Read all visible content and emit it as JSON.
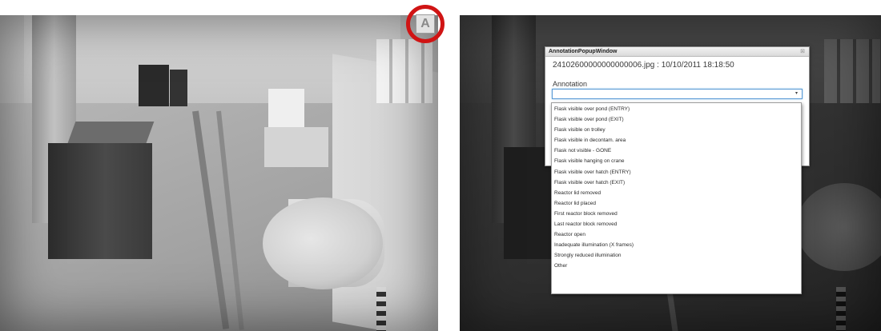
{
  "overlay_button": {
    "label": "A"
  },
  "popup": {
    "title": "AnnotationPopupWindow",
    "close_glyph": "⊠",
    "file_info": "24102600000000000006.jpg : 10/10/2011 18:18:50",
    "annotation_label": "Annotation",
    "select_value": "",
    "caret_glyph": "▾"
  },
  "dropdown": {
    "items": [
      "Flask visible over pond (ENTRY)",
      "Flask visible over pond (EXIT)",
      "Flask visible on trolley",
      "Flask visible in decontam. area",
      "Flask not visible - GONE",
      "Flask visible hanging on crane",
      "Flask visible over hatch (ENTRY)",
      "Flask visible over hatch (EXIT)",
      "Reactor lid removed",
      "Reactor lid placed",
      "First reactor block removed",
      "Last reactor block removed",
      "Reactor open",
      "Inadequate illumination (X frames)",
      "Strongly reduced illumination",
      "Other"
    ]
  },
  "colors": {
    "highlight_ring": "#d01414",
    "select_focus_border": "#5b9bd5"
  }
}
